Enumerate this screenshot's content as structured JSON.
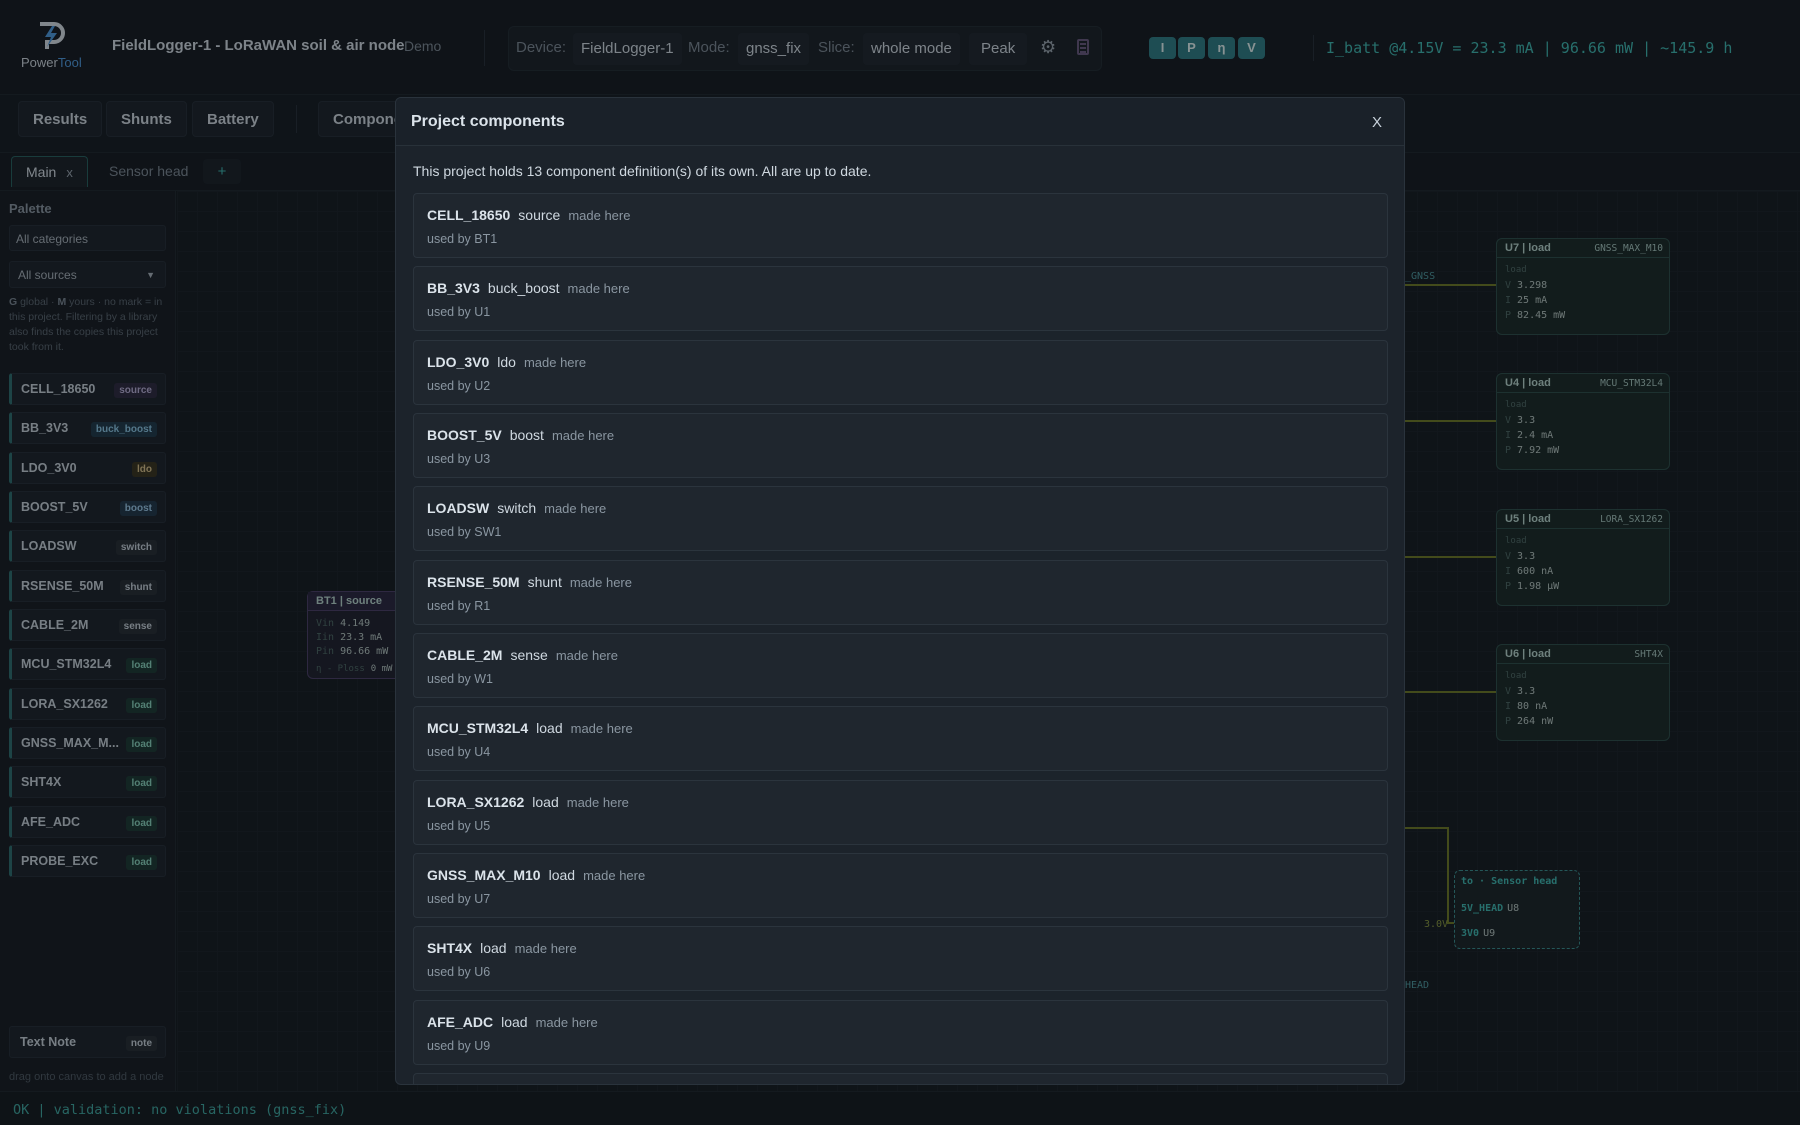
{
  "header": {
    "logo_text_a": "Power",
    "logo_text_b": "Tool",
    "title": "FieldLogger-1 - LoRaWAN soil & air node",
    "demo": "Demo",
    "device_label": "Device:",
    "device_value": "FieldLogger-1",
    "mode_label": "Mode:",
    "mode_value": "gnss_fix",
    "slice_label": "Slice:",
    "slice_value": "whole mode",
    "peak_label": "Peak",
    "chips": [
      "I",
      "P",
      "η",
      "V"
    ],
    "battery_readout": "I_batt @4.15V = 23.3 mA | 96.66 mW | ~145.9 h"
  },
  "toolbar": {
    "results": "Results",
    "shunts": "Shunts",
    "battery": "Battery",
    "components": "Components"
  },
  "tabs": {
    "main": "Main",
    "main_close": "x",
    "sensor_head": "Sensor head",
    "add": "+"
  },
  "sidebar": {
    "title": "Palette",
    "category_input": "All categories",
    "source_select": "All sources",
    "hint_g": "G",
    "hint_1": " global · ",
    "hint_m": "M",
    "hint_2": " yours · no mark = in this project. Filtering by a library also finds the copies this project took from it.",
    "items": [
      {
        "name": "CELL_18650",
        "tag": "source"
      },
      {
        "name": "BB_3V3",
        "tag": "buck_boost"
      },
      {
        "name": "LDO_3V0",
        "tag": "ldo"
      },
      {
        "name": "BOOST_5V",
        "tag": "boost"
      },
      {
        "name": "LOADSW",
        "tag": "switch"
      },
      {
        "name": "RSENSE_50M",
        "tag": "shunt"
      },
      {
        "name": "CABLE_2M",
        "tag": "sense"
      },
      {
        "name": "MCU_STM32L4",
        "tag": "load"
      },
      {
        "name": "LORA_SX1262",
        "tag": "load"
      },
      {
        "name": "GNSS_MAX_M...",
        "tag": "load"
      },
      {
        "name": "SHT4X",
        "tag": "load"
      },
      {
        "name": "AFE_ADC",
        "tag": "load"
      },
      {
        "name": "PROBE_EXC",
        "tag": "load"
      }
    ],
    "note_name": "Text Note",
    "note_tag": "note",
    "footer": "drag onto canvas to add a node"
  },
  "canvas": {
    "bt1": {
      "title": "BT1 | source",
      "vin_k": "Vin",
      "vin": "4.149",
      "iin_k": "Iin",
      "iin": "23.3 mA",
      "pin_k": "Pin",
      "pin": "96.66 mW",
      "ploss": "η - Ploss",
      "ploss_v": "0 mW"
    },
    "loads": [
      {
        "title": "U7 | load",
        "part": "GNSS_MAX_M10",
        "kind": "load",
        "v": "3.298",
        "i": "25 mA",
        "p": "82.45 mW"
      },
      {
        "title": "U4 | load",
        "part": "MCU_STM32L4",
        "kind": "load",
        "v": "3.3",
        "i": "2.4 mA",
        "p": "7.92 mW"
      },
      {
        "title": "U5 | load",
        "part": "LORA_SX1262",
        "kind": "load",
        "v": "3.3",
        "i": "600 nA",
        "p": "1.98 µW"
      },
      {
        "title": "U6 | load",
        "part": "SHT4X",
        "kind": "load",
        "v": "3.3",
        "i": "80 nA",
        "p": "264 nW"
      }
    ],
    "kv_v": "V",
    "kv_i": "I",
    "kv_p": "P",
    "wire_label_gnss": "_GNSS",
    "wire_label_3v": "3.0V",
    "wire_label_head": "HEAD",
    "portal": {
      "title": "to · Sensor head",
      "row1_net": "5V_HEAD",
      "row1_ref": "U8",
      "row2_net": "3V0",
      "row2_ref": "U9"
    }
  },
  "modal": {
    "title": "Project components",
    "close": "X",
    "intro": "This project holds 13 component definition(s) of its own. All are up to date.",
    "components": [
      {
        "name": "CELL_18650",
        "type": "source",
        "origin": "made here",
        "used_by": "used by BT1"
      },
      {
        "name": "BB_3V3",
        "type": "buck_boost",
        "origin": "made here",
        "used_by": "used by U1"
      },
      {
        "name": "LDO_3V0",
        "type": "ldo",
        "origin": "made here",
        "used_by": "used by U2"
      },
      {
        "name": "BOOST_5V",
        "type": "boost",
        "origin": "made here",
        "used_by": "used by U3"
      },
      {
        "name": "LOADSW",
        "type": "switch",
        "origin": "made here",
        "used_by": "used by SW1"
      },
      {
        "name": "RSENSE_50M",
        "type": "shunt",
        "origin": "made here",
        "used_by": "used by R1"
      },
      {
        "name": "CABLE_2M",
        "type": "sense",
        "origin": "made here",
        "used_by": "used by W1"
      },
      {
        "name": "MCU_STM32L4",
        "type": "load",
        "origin": "made here",
        "used_by": "used by U4"
      },
      {
        "name": "LORA_SX1262",
        "type": "load",
        "origin": "made here",
        "used_by": "used by U5"
      },
      {
        "name": "GNSS_MAX_M10",
        "type": "load",
        "origin": "made here",
        "used_by": "used by U7"
      },
      {
        "name": "SHT4X",
        "type": "load",
        "origin": "made here",
        "used_by": "used by U6"
      },
      {
        "name": "AFE_ADC",
        "type": "load",
        "origin": "made here",
        "used_by": "used by U9"
      }
    ]
  },
  "status": {
    "text": "OK | validation: no violations (gnss_fix)"
  },
  "colors": {
    "accent": "#3fb9b2",
    "chip": "#2f7f87",
    "wire": "#6e7a26"
  },
  "icons": {
    "settings": "gear-icon",
    "calculator": "calculator-icon",
    "dropdown": "chevron-down-icon"
  }
}
